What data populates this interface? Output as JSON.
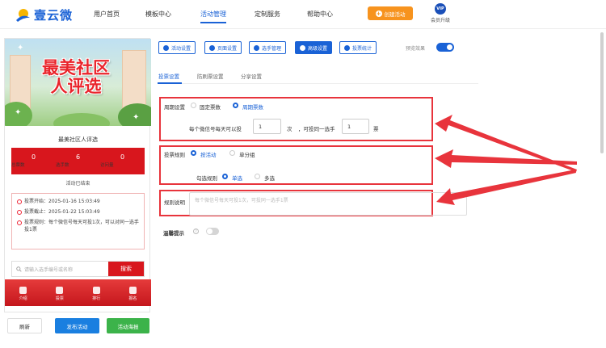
{
  "header": {
    "logo_text": "壹云微",
    "nav": [
      "用户首页",
      "模板中心",
      "活动管理",
      "定制服务",
      "帮助中心"
    ],
    "active_nav": "活动管理",
    "create_button": "创建活动",
    "vip_badge": "VIP",
    "vip_label": "会员升级"
  },
  "preview_panel": {
    "banner_title_line1": "最美社区",
    "banner_title_line2": "人评选",
    "title": "最美社区人评选",
    "stats": [
      {
        "value": "0",
        "label": "总票数"
      },
      {
        "value": "6",
        "label": "选手数"
      },
      {
        "value": "0",
        "label": "访问量"
      }
    ],
    "status": "活动已结束",
    "info": [
      "投票开始：2025-01-16 15:03:49",
      "投票截止：2025-01-22 15:03:49",
      "投票规则：每个微信号每天可投1次，可以对同一选手投1票"
    ],
    "search_placeholder": "请输入选手编号或名称",
    "search_button": "搜索",
    "bottom_tabs": [
      "介绍",
      "投票",
      "排行",
      "报名"
    ]
  },
  "actions": {
    "refresh": "刷新",
    "publish": "发布活动",
    "poster": "活动海报"
  },
  "toolbar": {
    "buttons": [
      "活动设置",
      "页面设置",
      "选手管理",
      "高级设置",
      "投票统计"
    ],
    "active": "高级设置",
    "preview_label": "预览效果"
  },
  "subtabs": [
    "投票设置",
    "防刷票设置",
    "分享设置"
  ],
  "form": {
    "cycle_label": "周期设置",
    "cycle_options": [
      "固定票数",
      "周期票数"
    ],
    "cycle_selected": "周期票数",
    "per_day_prefix": "每个微信号每天可以投",
    "per_day_value": "1",
    "per_day_unit": "次",
    "same_player_prefix": "，可投同一选手",
    "same_player_value": "1",
    "same_player_unit": "票",
    "rule_label": "投票规则",
    "rule_options": [
      "按活动",
      "单分组"
    ],
    "rule_selected": "按活动",
    "check_label": "勾选规则",
    "check_options": [
      "单选",
      "多选"
    ],
    "check_selected": "单选",
    "desc_label": "规则说明",
    "desc_placeholder": "每个微信号每天可投1次，可投同一选手1票",
    "warm_tip_label": "温馨提示"
  }
}
